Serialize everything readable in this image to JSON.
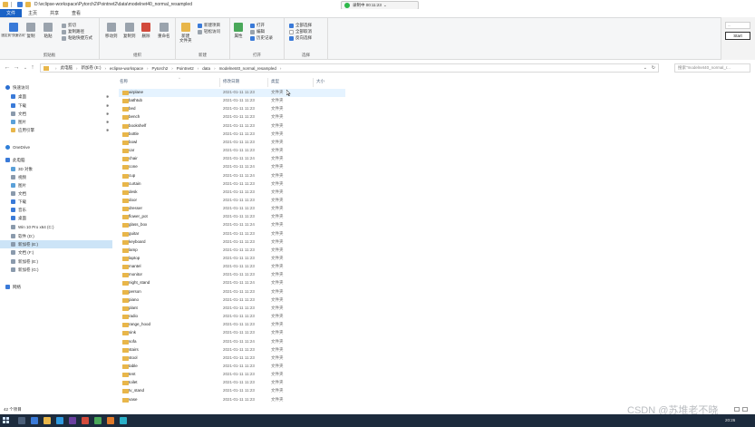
{
  "window": {
    "title": "D:\\eclipse-workspace\\Pytorch2\\Pointnet2\\data\\modelnet40_normal_resampled",
    "recording_label": "录制中 00:11:23",
    "rec_caret": "⌄"
  },
  "ribbon_tabs": [
    "文件",
    "主页",
    "共享",
    "查看"
  ],
  "ribbon": {
    "clipboard": {
      "label": "剪贴板",
      "pin": "固定到\"快速访问\"",
      "copy": "复制",
      "paste": "粘贴",
      "cut": "剪切",
      "copy_path": "复制路径",
      "paste_shortcut": "粘贴快捷方式"
    },
    "organize": {
      "label": "组织",
      "move_to": "移动到",
      "copy_to": "复制到",
      "delete": "删除",
      "rename": "重命名"
    },
    "new": {
      "label": "新建",
      "new_folder": "新建\n文件夹",
      "new_item": "新建项目",
      "easy_access": "轻松访问"
    },
    "open": {
      "label": "打开",
      "properties": "属性",
      "open": "打开",
      "edit": "编辑",
      "history": "历史记录"
    },
    "select": {
      "label": "选择",
      "select_all": "全部选择",
      "select_none": "全部取消",
      "invert": "反向选择"
    },
    "side_field": "...",
    "start_button": "Start"
  },
  "address": {
    "back": "←",
    "forward": "→",
    "recent": "⌄",
    "up": "↑",
    "crumbs": [
      "此电脑",
      "新加卷 (E:)",
      "eclipse-workspace",
      "Pytorch2",
      "Pointnet2",
      "data",
      "modelnet40_normal_resampled"
    ],
    "separator": "›",
    "search_placeholder": "搜索\"modelnet40_normal_r...",
    "dropdown": "⌄",
    "refresh": "↻"
  },
  "nav_pane": {
    "items": [
      {
        "label": "快速访问",
        "icon": "star-icon",
        "pinned": false
      },
      {
        "label": "桌面",
        "icon": "desktop-icon",
        "pinned": true
      },
      {
        "label": "下载",
        "icon": "download-icon",
        "pinned": true
      },
      {
        "label": "文档",
        "icon": "document-icon",
        "pinned": true
      },
      {
        "label": "图片",
        "icon": "picture-icon",
        "pinned": true
      },
      {
        "label": "应用引擎",
        "icon": "folder-icon",
        "pinned": true
      },
      {
        "label": "OneDrive",
        "icon": "cloud-icon",
        "pinned": false
      },
      {
        "label": "此电脑",
        "icon": "computer-icon",
        "pinned": false
      },
      {
        "label": "3D 对象",
        "icon": "cube-icon",
        "pinned": false
      },
      {
        "label": "视频",
        "icon": "video-icon",
        "pinned": false
      },
      {
        "label": "图片",
        "icon": "picture-icon",
        "pinned": false
      },
      {
        "label": "文档",
        "icon": "document-icon",
        "pinned": false
      },
      {
        "label": "下载",
        "icon": "download-icon",
        "pinned": false
      },
      {
        "label": "音乐",
        "icon": "music-icon",
        "pinned": false
      },
      {
        "label": "桌面",
        "icon": "desktop-icon",
        "pinned": false
      },
      {
        "label": "Win 10 Pro x64 (C:)",
        "icon": "drive-icon",
        "pinned": false
      },
      {
        "label": "软件 (D:)",
        "icon": "drive-icon",
        "pinned": false
      },
      {
        "label": "新加卷 (E:)",
        "icon": "drive-icon",
        "pinned": false,
        "selected": true
      },
      {
        "label": "文档 (F:)",
        "icon": "drive-icon",
        "pinned": false
      },
      {
        "label": "新加卷 (E:)",
        "icon": "drive-icon",
        "pinned": false
      },
      {
        "label": "新加卷 (G:)",
        "icon": "drive-icon",
        "pinned": false
      },
      {
        "label": "网络",
        "icon": "network-icon",
        "pinned": false
      }
    ],
    "pin_glyph": "✱"
  },
  "file_list": {
    "headers": {
      "name": "名称",
      "date": "修改日期",
      "type": "类型",
      "size": "大小"
    },
    "sort_caret": "^",
    "rows": [
      {
        "name": "airplane",
        "date": "2021-01-11 11:23",
        "type": "文件夹",
        "hover": true
      },
      {
        "name": "bathtub",
        "date": "2021-01-11 11:23",
        "type": "文件夹"
      },
      {
        "name": "bed",
        "date": "2021-01-11 11:23",
        "type": "文件夹"
      },
      {
        "name": "bench",
        "date": "2021-01-11 11:23",
        "type": "文件夹"
      },
      {
        "name": "bookshelf",
        "date": "2021-01-11 11:23",
        "type": "文件夹"
      },
      {
        "name": "bottle",
        "date": "2021-01-11 11:23",
        "type": "文件夹"
      },
      {
        "name": "bowl",
        "date": "2021-01-11 11:23",
        "type": "文件夹"
      },
      {
        "name": "car",
        "date": "2021-01-11 11:23",
        "type": "文件夹"
      },
      {
        "name": "chair",
        "date": "2021-01-11 11:24",
        "type": "文件夹"
      },
      {
        "name": "cone",
        "date": "2021-01-11 11:24",
        "type": "文件夹"
      },
      {
        "name": "cup",
        "date": "2021-01-11 11:24",
        "type": "文件夹"
      },
      {
        "name": "curtain",
        "date": "2021-01-11 11:23",
        "type": "文件夹"
      },
      {
        "name": "desk",
        "date": "2021-01-11 11:23",
        "type": "文件夹"
      },
      {
        "name": "door",
        "date": "2021-01-11 11:23",
        "type": "文件夹"
      },
      {
        "name": "dresser",
        "date": "2021-01-11 11:23",
        "type": "文件夹"
      },
      {
        "name": "flower_pot",
        "date": "2021-01-11 11:23",
        "type": "文件夹"
      },
      {
        "name": "glass_box",
        "date": "2021-01-11 11:24",
        "type": "文件夹"
      },
      {
        "name": "guitar",
        "date": "2021-01-11 11:23",
        "type": "文件夹"
      },
      {
        "name": "keyboard",
        "date": "2021-01-11 11:23",
        "type": "文件夹"
      },
      {
        "name": "lamp",
        "date": "2021-01-11 11:23",
        "type": "文件夹"
      },
      {
        "name": "laptop",
        "date": "2021-01-11 11:23",
        "type": "文件夹"
      },
      {
        "name": "mantel",
        "date": "2021-01-11 11:23",
        "type": "文件夹"
      },
      {
        "name": "monitor",
        "date": "2021-01-11 11:23",
        "type": "文件夹"
      },
      {
        "name": "night_stand",
        "date": "2021-01-11 11:24",
        "type": "文件夹"
      },
      {
        "name": "person",
        "date": "2021-01-11 11:23",
        "type": "文件夹"
      },
      {
        "name": "piano",
        "date": "2021-01-11 11:23",
        "type": "文件夹"
      },
      {
        "name": "plant",
        "date": "2021-01-11 11:23",
        "type": "文件夹"
      },
      {
        "name": "radio",
        "date": "2021-01-11 11:23",
        "type": "文件夹"
      },
      {
        "name": "range_hood",
        "date": "2021-01-11 11:23",
        "type": "文件夹"
      },
      {
        "name": "sink",
        "date": "2021-01-11 11:23",
        "type": "文件夹"
      },
      {
        "name": "sofa",
        "date": "2021-01-11 11:24",
        "type": "文件夹"
      },
      {
        "name": "stairs",
        "date": "2021-01-11 11:23",
        "type": "文件夹"
      },
      {
        "name": "stool",
        "date": "2021-01-11 11:23",
        "type": "文件夹"
      },
      {
        "name": "table",
        "date": "2021-01-11 11:23",
        "type": "文件夹"
      },
      {
        "name": "tent",
        "date": "2021-01-11 11:23",
        "type": "文件夹"
      },
      {
        "name": "toilet",
        "date": "2021-01-11 11:23",
        "type": "文件夹"
      },
      {
        "name": "tv_stand",
        "date": "2021-01-11 11:23",
        "type": "文件夹"
      },
      {
        "name": "vase",
        "date": "2021-01-11 11:23",
        "type": "文件夹"
      }
    ]
  },
  "status": {
    "item_count": "42 个项目"
  },
  "watermark": "CSDN @苏堆老不晓",
  "clock": "20:26",
  "colors": {
    "accent": "#1a62c6",
    "folder": "#e8b64a",
    "selection": "#cce4f7",
    "hover": "#e5f3ff",
    "taskbar": "#1c2b3d"
  }
}
